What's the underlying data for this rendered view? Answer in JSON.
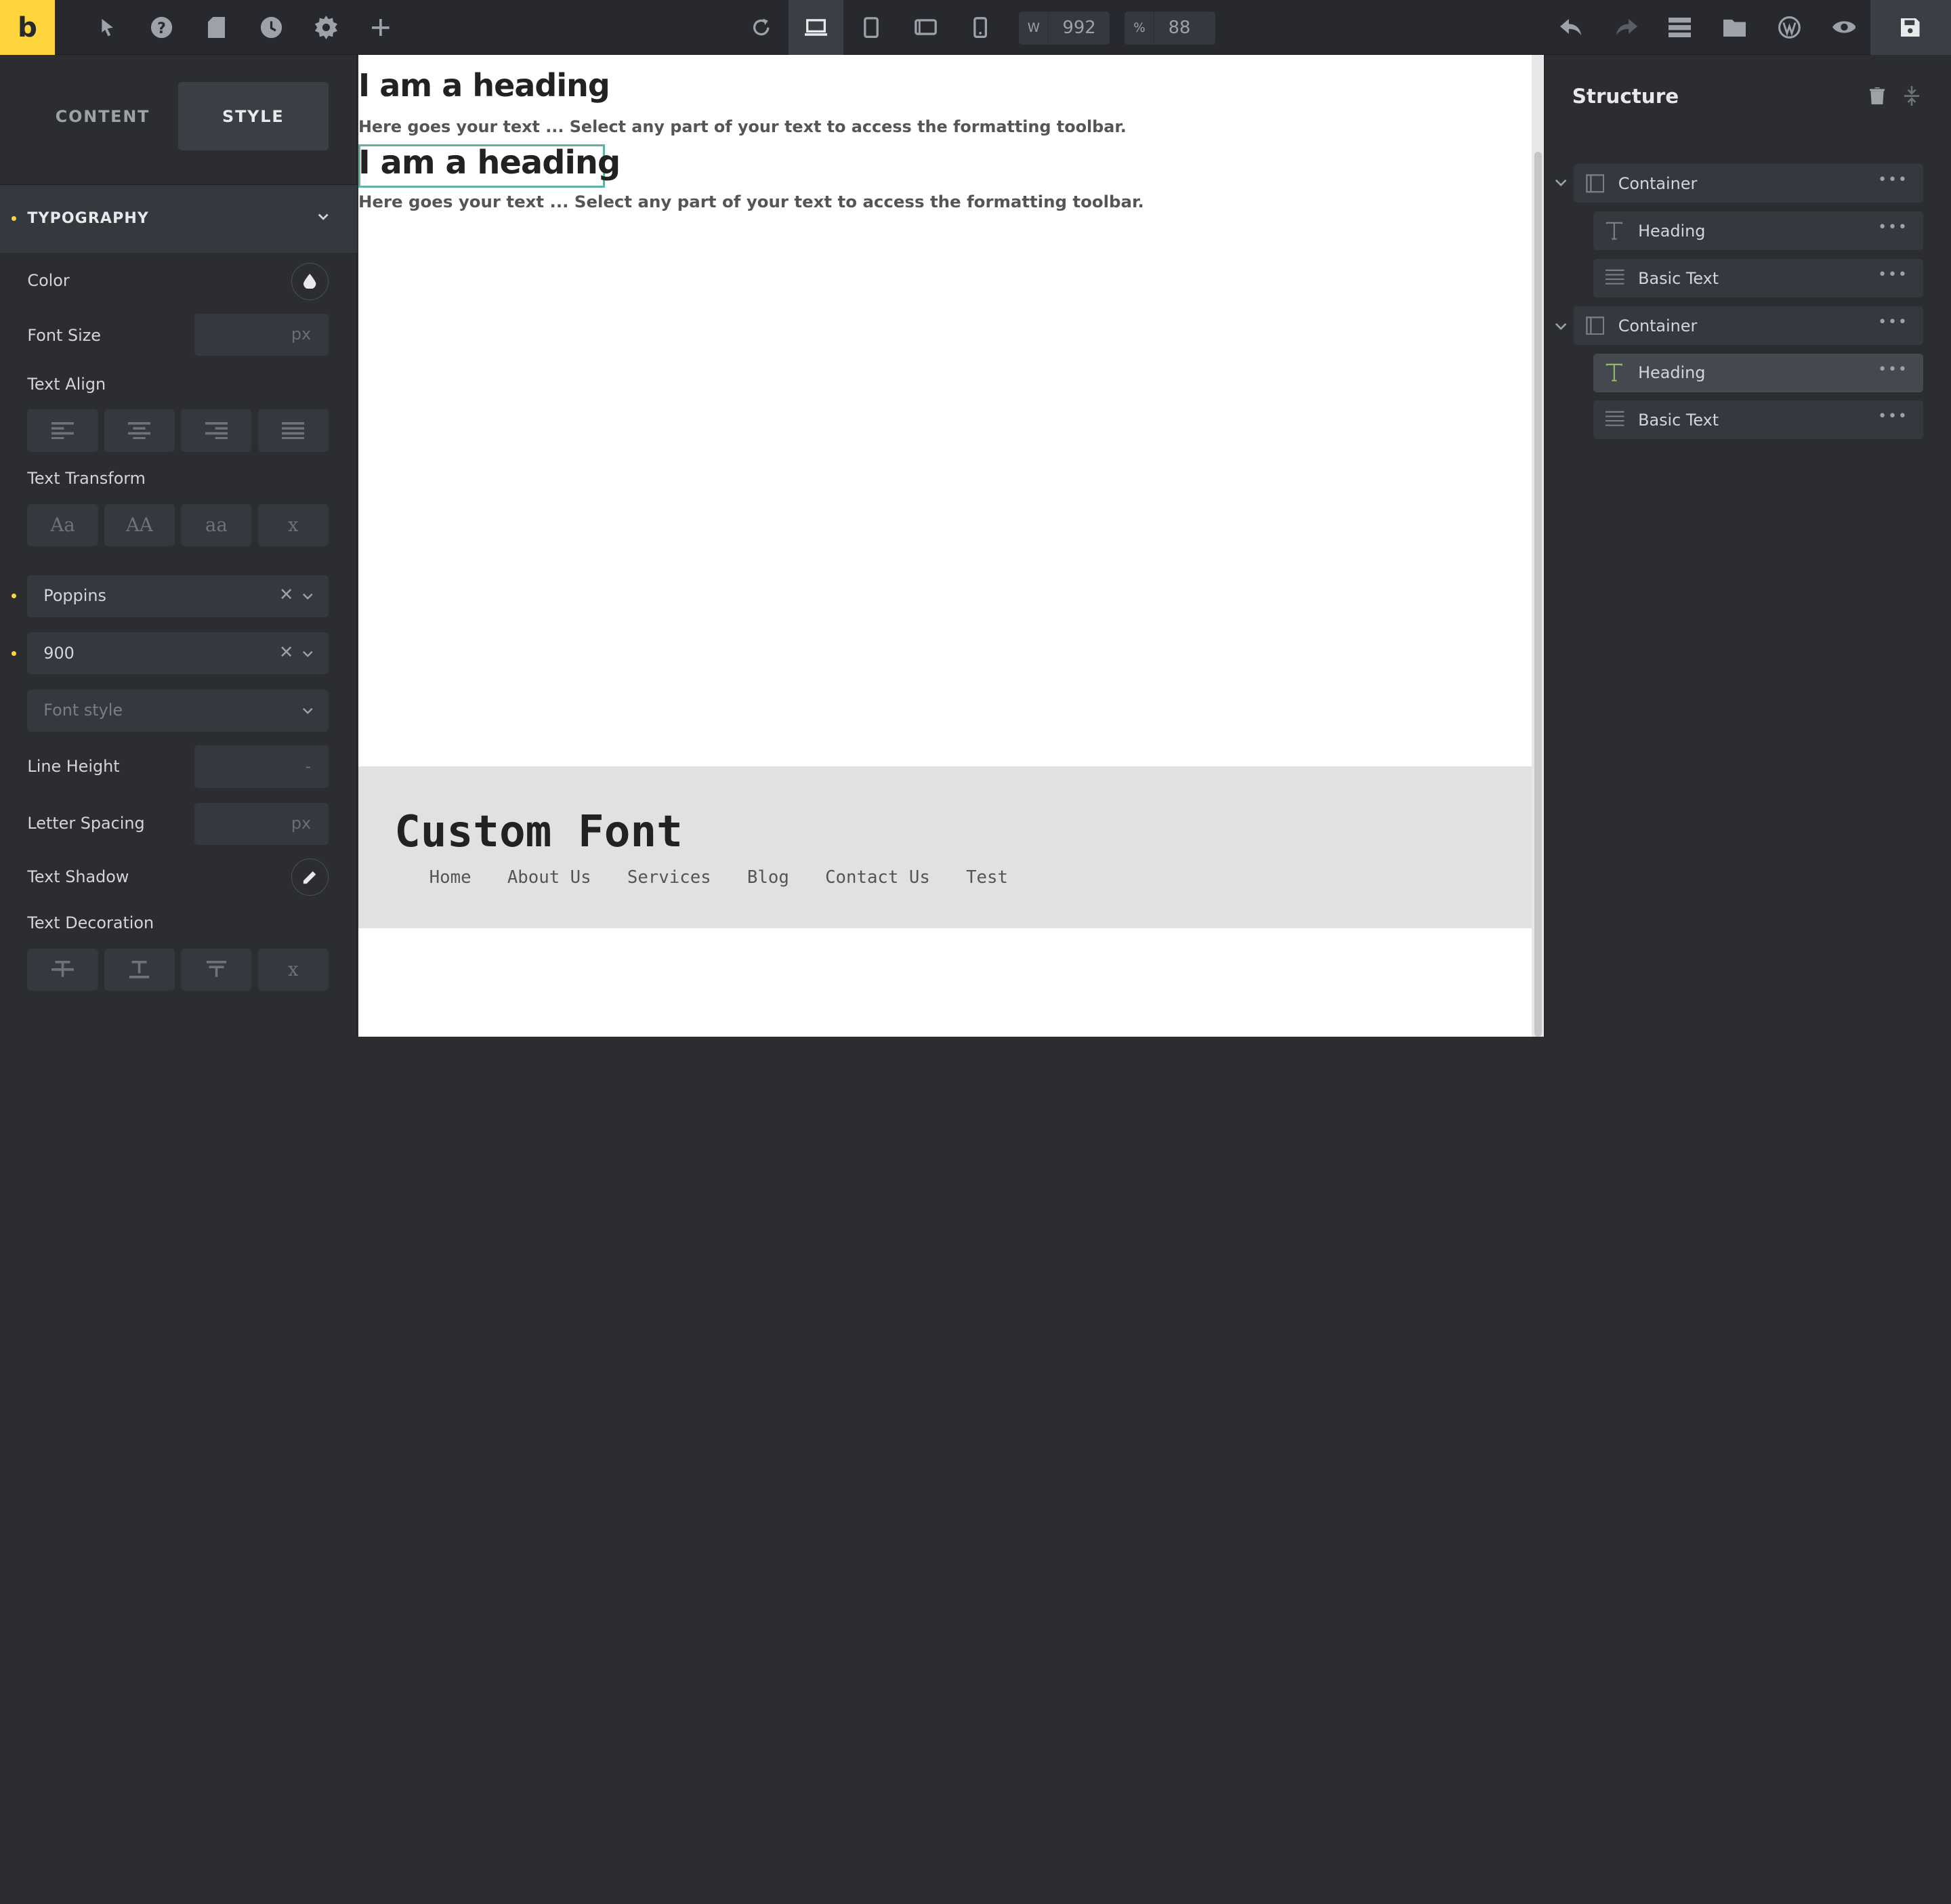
{
  "toolbar": {
    "logo": "b",
    "width_label": "W",
    "width_value": "992",
    "zoom_label": "%",
    "zoom_value": "88"
  },
  "left_panel": {
    "tabs": [
      {
        "label": "CONTENT"
      },
      {
        "label": "STYLE"
      }
    ],
    "active_tab": "STYLE",
    "section_title": "TYPOGRAPHY",
    "color_label": "Color",
    "font_size_label": "Font Size",
    "font_size_unit": "px",
    "text_align_label": "Text Align",
    "text_transform_label": "Text Transform",
    "text_transform_options": [
      "Aa",
      "AA",
      "aa",
      "x"
    ],
    "font_family_value": "Poppins",
    "font_weight_value": "900",
    "font_style_placeholder": "Font style",
    "line_height_label": "Line Height",
    "line_height_unit": "-",
    "letter_spacing_label": "Letter Spacing",
    "letter_spacing_unit": "px",
    "text_shadow_label": "Text Shadow",
    "text_decoration_label": "Text Decoration",
    "text_decoration_clear": "x"
  },
  "canvas": {
    "heading_1": "I am a heading",
    "text_1": "Here goes your text ... Select any part of your text to access the formatting toolbar.",
    "heading_2": "I am a heading",
    "text_2": "Here goes your text ... Select any part of your text to access the formatting toolbar.",
    "footer_title": "Custom Font",
    "footer_nav": [
      "Home",
      "About Us",
      "Services",
      "Blog",
      "Contact Us",
      "Test"
    ]
  },
  "structure": {
    "title": "Structure",
    "nodes": [
      {
        "label": "Container",
        "type": "container",
        "active": false
      },
      {
        "label": "Heading",
        "type": "heading",
        "active": false
      },
      {
        "label": "Basic Text",
        "type": "text",
        "active": false
      },
      {
        "label": "Container",
        "type": "container",
        "active": false
      },
      {
        "label": "Heading",
        "type": "heading",
        "active": true
      },
      {
        "label": "Basic Text",
        "type": "text",
        "active": false
      }
    ]
  },
  "colors": {
    "brand": "#ffd53e",
    "selection": "#5fb3a1",
    "panel": "#2b2d31"
  }
}
